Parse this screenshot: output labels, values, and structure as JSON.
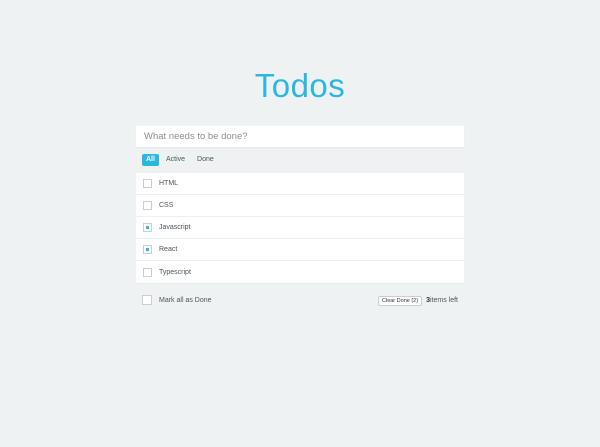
{
  "app": {
    "title": "Todos"
  },
  "new_todo": {
    "placeholder": "What needs to be done?",
    "value": ""
  },
  "filters": [
    {
      "label": "All",
      "active": true
    },
    {
      "label": "Active",
      "active": false
    },
    {
      "label": "Done",
      "active": false
    }
  ],
  "todos": [
    {
      "text": "HTML",
      "done": false
    },
    {
      "text": "CSS",
      "done": false
    },
    {
      "text": "Javascript",
      "done": true
    },
    {
      "text": "React",
      "done": true
    },
    {
      "text": "Typescript",
      "done": false
    }
  ],
  "footer": {
    "mark_all_label": "Mark all as Done",
    "clear_done_label": "Clear Done (2)",
    "items_left_count": "3",
    "items_left_suffix": "items left"
  },
  "colors": {
    "accent": "#2bb8e0",
    "background": "#eef2f3"
  }
}
